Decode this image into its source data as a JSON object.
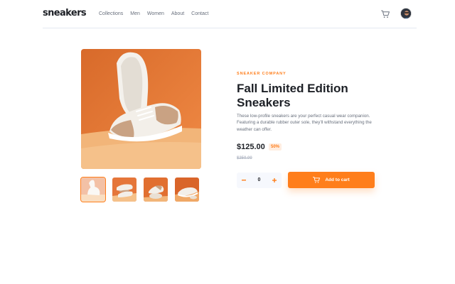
{
  "header": {
    "logo": "sneakers",
    "nav": [
      "Collections",
      "Men",
      "Women",
      "About",
      "Contact"
    ],
    "icons": {
      "cart": "cart-icon",
      "avatar": "avatar"
    }
  },
  "product": {
    "company": "SNEAKER COMPANY",
    "title": "Fall Limited Edition Sneakers",
    "description": "These low-profile sneakers are your perfect casual wear companion. Featuring a durable rubber outer sole, they’ll withstand everything the weather can offer.",
    "price": "$125.00",
    "discount": "50%",
    "original_price": "$250.00",
    "quantity": "0",
    "add_to_cart": "Add to cart"
  },
  "colors": {
    "accent": "#ff7e1b",
    "accent_pale": "#ffede0",
    "text_dark": "#1d2026",
    "text_muted": "#69707d",
    "qty_bg": "#f6f8fd"
  }
}
